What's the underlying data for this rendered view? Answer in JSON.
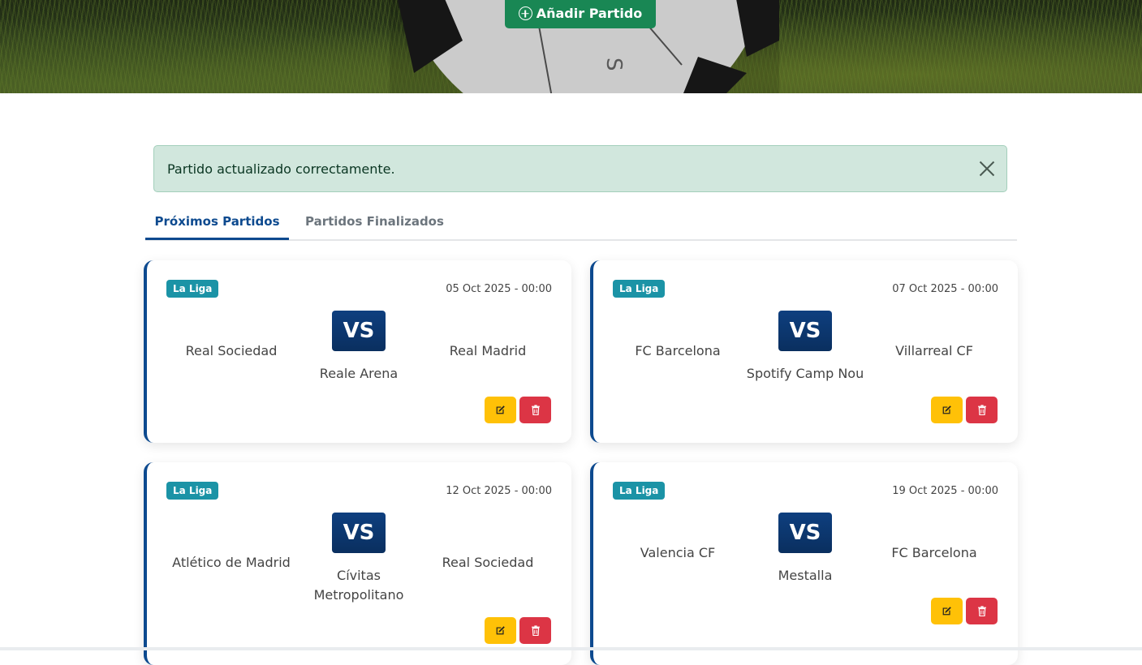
{
  "header": {
    "add_button_label": "Añadir Partido"
  },
  "alert": {
    "message": "Partido actualizado correctamente."
  },
  "tabs": [
    {
      "label": "Próximos Partidos",
      "active": true
    },
    {
      "label": "Partidos Finalizados",
      "active": false
    }
  ],
  "matches": [
    {
      "league": "La Liga",
      "date": "05 Oct 2025 - 00:00",
      "home": "Real Sociedad",
      "vs": "VS",
      "stadium": "Reale Arena",
      "away": "Real Madrid"
    },
    {
      "league": "La Liga",
      "date": "07 Oct 2025 - 00:00",
      "home": "FC Barcelona",
      "vs": "VS",
      "stadium": "Spotify Camp Nou",
      "away": "Villarreal CF"
    },
    {
      "league": "La Liga",
      "date": "12 Oct 2025 - 00:00",
      "home": "Atlético de Madrid",
      "vs": "VS",
      "stadium": "Cívitas Metropolitano",
      "away": "Real Sociedad"
    },
    {
      "league": "La Liga",
      "date": "19 Oct 2025 - 00:00",
      "home": "Valencia CF",
      "vs": "VS",
      "stadium": "Mestalla",
      "away": "FC Barcelona"
    }
  ],
  "icons": {
    "add": "plus-circle-icon",
    "close": "close-icon",
    "edit": "edit-icon",
    "delete": "trash-icon"
  },
  "colors": {
    "primary": "#0d4a8f",
    "success": "#198754",
    "alert_bg": "#d1e7dd",
    "badge": "#1b93a6",
    "edit": "#ffc107",
    "delete": "#dc3545"
  }
}
